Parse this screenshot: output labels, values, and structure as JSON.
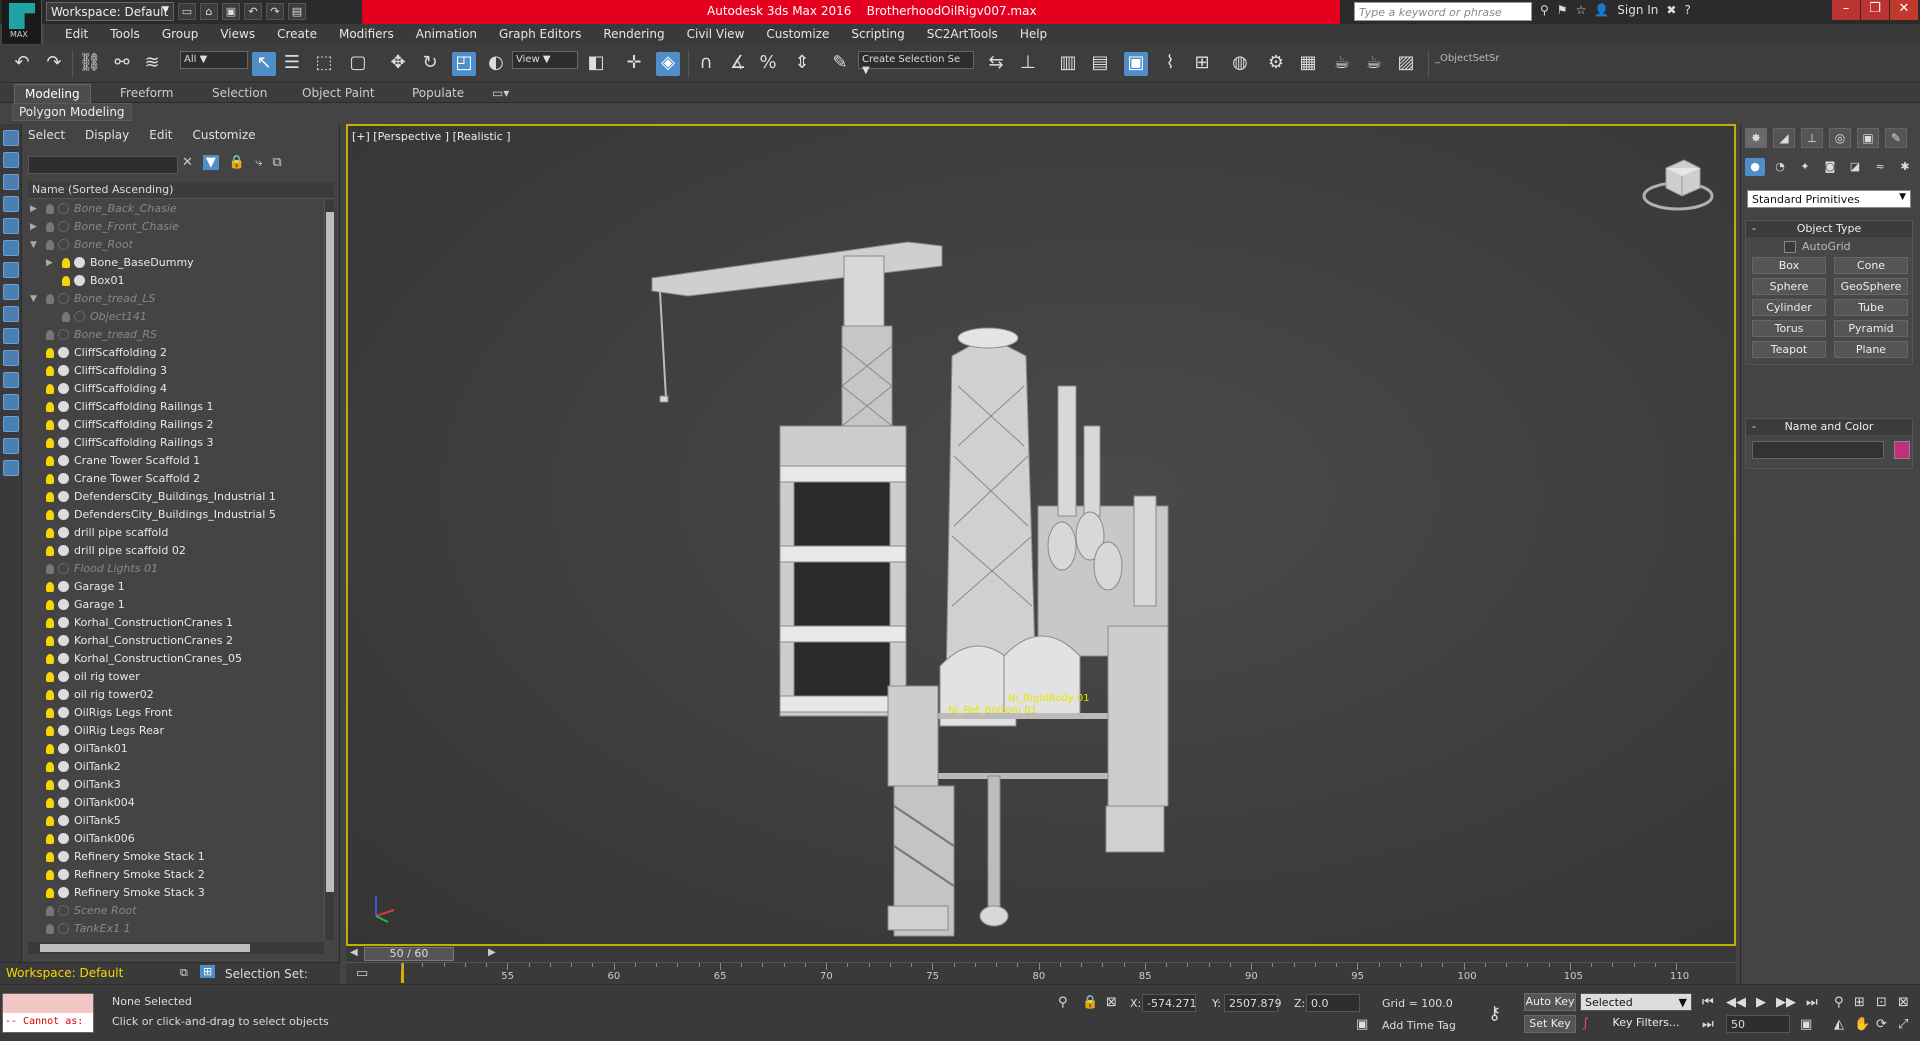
{
  "app": {
    "title": "Autodesk 3ds Max 2016    BrotherhoodOilRigv007.max",
    "workspace": "Workspace: Default",
    "search_placeholder": "Type a keyword or phrase",
    "sign_in": "Sign In",
    "logo_text": "MAX"
  },
  "menu": [
    "Edit",
    "Tools",
    "Group",
    "Views",
    "Create",
    "Modifiers",
    "Animation",
    "Graph Editors",
    "Rendering",
    "Civil View",
    "Customize",
    "Scripting",
    "SC2ArtTools",
    "Help"
  ],
  "toolbar": {
    "filter_value": "All",
    "ref_coord": "View",
    "selection_set_placeholder": "Create Selection Se",
    "named_sets": "_ObjectSetSr"
  },
  "ribbon": {
    "tabs": [
      "Modeling",
      "Freeform",
      "Selection",
      "Object Paint",
      "Populate"
    ],
    "active_tab": "Modeling",
    "sub_label": "Polygon Modeling"
  },
  "explorer": {
    "menu": [
      "Select",
      "Display",
      "Edit",
      "Customize"
    ],
    "column_header": "Name (Sorted Ascending)",
    "items": [
      {
        "name": "Bone_Back_Chasie",
        "hidden": true,
        "indent": 0,
        "expander": "▶"
      },
      {
        "name": "Bone_Front_Chasie",
        "hidden": true,
        "indent": 0,
        "expander": "▶"
      },
      {
        "name": "Bone_Root",
        "hidden": true,
        "indent": 0,
        "expander": "▼"
      },
      {
        "name": "Bone_BaseDummy",
        "hidden": false,
        "indent": 1,
        "expander": "▶"
      },
      {
        "name": "Box01",
        "hidden": false,
        "indent": 1,
        "expander": ""
      },
      {
        "name": "Bone_tread_LS",
        "hidden": true,
        "indent": 0,
        "expander": "▼"
      },
      {
        "name": "Object141",
        "hidden": true,
        "indent": 1,
        "expander": ""
      },
      {
        "name": "Bone_tread_RS",
        "hidden": true,
        "indent": 0,
        "expander": ""
      },
      {
        "name": "CliffScaffolding 2",
        "hidden": false,
        "indent": 0,
        "expander": ""
      },
      {
        "name": "CliffScaffolding 3",
        "hidden": false,
        "indent": 0,
        "expander": ""
      },
      {
        "name": "CliffScaffolding 4",
        "hidden": false,
        "indent": 0,
        "expander": ""
      },
      {
        "name": "CliffScaffolding Railings 1",
        "hidden": false,
        "indent": 0,
        "expander": ""
      },
      {
        "name": "CliffScaffolding Railings 2",
        "hidden": false,
        "indent": 0,
        "expander": ""
      },
      {
        "name": "CliffScaffolding Railings 3",
        "hidden": false,
        "indent": 0,
        "expander": ""
      },
      {
        "name": "Crane Tower Scaffold 1",
        "hidden": false,
        "indent": 0,
        "expander": ""
      },
      {
        "name": "Crane Tower Scaffold 2",
        "hidden": false,
        "indent": 0,
        "expander": ""
      },
      {
        "name": "DefendersCity_Buildings_Industrial 1",
        "hidden": false,
        "indent": 0,
        "expander": ""
      },
      {
        "name": "DefendersCity_Buildings_Industrial 5",
        "hidden": false,
        "indent": 0,
        "expander": ""
      },
      {
        "name": "drill pipe scaffold",
        "hidden": false,
        "indent": 0,
        "expander": ""
      },
      {
        "name": "drill pipe scaffold 02",
        "hidden": false,
        "indent": 0,
        "expander": ""
      },
      {
        "name": "Flood Lights 01",
        "hidden": true,
        "indent": 0,
        "expander": ""
      },
      {
        "name": "Garage 1",
        "hidden": false,
        "indent": 0,
        "expander": ""
      },
      {
        "name": "Garage 1",
        "hidden": false,
        "indent": 0,
        "expander": ""
      },
      {
        "name": "Korhal_ConstructionCranes 1",
        "hidden": false,
        "indent": 0,
        "expander": ""
      },
      {
        "name": "Korhal_ConstructionCranes 2",
        "hidden": false,
        "indent": 0,
        "expander": ""
      },
      {
        "name": "Korhal_ConstructionCranes_05",
        "hidden": false,
        "indent": 0,
        "expander": ""
      },
      {
        "name": "oil rig tower",
        "hidden": false,
        "indent": 0,
        "expander": ""
      },
      {
        "name": "oil rig tower02",
        "hidden": false,
        "indent": 0,
        "expander": ""
      },
      {
        "name": "OilRigs Legs Front",
        "hidden": false,
        "indent": 0,
        "expander": ""
      },
      {
        "name": "OilRig Legs Rear",
        "hidden": false,
        "indent": 0,
        "expander": ""
      },
      {
        "name": "OilTank01",
        "hidden": false,
        "indent": 0,
        "expander": ""
      },
      {
        "name": "OilTank2",
        "hidden": false,
        "indent": 0,
        "expander": ""
      },
      {
        "name": "OilTank3",
        "hidden": false,
        "indent": 0,
        "expander": ""
      },
      {
        "name": "OilTank004",
        "hidden": false,
        "indent": 0,
        "expander": ""
      },
      {
        "name": "OilTank5",
        "hidden": false,
        "indent": 0,
        "expander": ""
      },
      {
        "name": "OilTank006",
        "hidden": false,
        "indent": 0,
        "expander": ""
      },
      {
        "name": "Refinery Smoke Stack 1",
        "hidden": false,
        "indent": 0,
        "expander": ""
      },
      {
        "name": "Refinery Smoke Stack 2",
        "hidden": false,
        "indent": 0,
        "expander": ""
      },
      {
        "name": "Refinery Smoke Stack 3",
        "hidden": false,
        "indent": 0,
        "expander": ""
      },
      {
        "name": "Scene Root",
        "hidden": true,
        "indent": 0,
        "expander": ""
      },
      {
        "name": "TankEx1 1",
        "hidden": true,
        "indent": 0,
        "expander": ""
      }
    ],
    "workspace_label": "Workspace: Default",
    "selection_set_label": "Selection Set:"
  },
  "viewport": {
    "label": "[+] [Perspective ] [Realistic ]",
    "helper_labels": [
      "Ni_RigidBody 01",
      "Ni_Ref_Bottom 01"
    ]
  },
  "command_panel": {
    "category": "Standard Primitives",
    "object_type_title": "Object Type",
    "autogrid": "AutoGrid",
    "primitives": [
      "Box",
      "Cone",
      "Sphere",
      "GeoSphere",
      "Cylinder",
      "Tube",
      "Torus",
      "Pyramid",
      "Teapot",
      "Plane"
    ],
    "name_color_title": "Name and Color",
    "object_color": "#c0307a"
  },
  "timeline": {
    "frame_display": "50 / 60",
    "current_frame": 50,
    "ticks": [
      55,
      60,
      65,
      70,
      75,
      80,
      85,
      90,
      95,
      100,
      105,
      110
    ]
  },
  "status": {
    "selection": "None Selected",
    "prompt": "Click or click-and-drag to select objects",
    "maxscript_output": "-- Cannot as:",
    "x": "-574.271",
    "y": "2507.879",
    "z": "0.0",
    "x_label": "X:",
    "y_label": "Y:",
    "z_label": "Z:",
    "grid": "Grid = 100.0",
    "add_time_tag": "Add Time Tag",
    "auto_key": "Auto Key",
    "set_key": "Set Key",
    "key_mode": "Selected",
    "key_filters": "Key Filters...",
    "frame_field": "50"
  }
}
